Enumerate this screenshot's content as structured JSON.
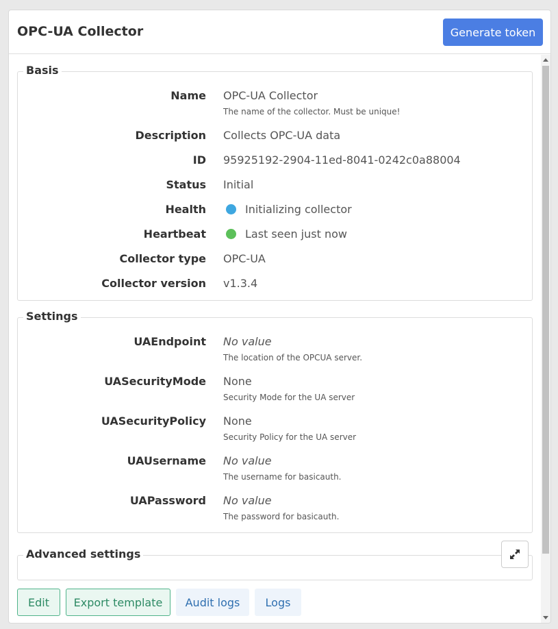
{
  "header": {
    "title": "OPC-UA Collector",
    "generate_token_label": "Generate token"
  },
  "basis": {
    "legend": "Basis",
    "name": {
      "label": "Name",
      "value": "OPC-UA Collector",
      "hint": "The name of the collector. Must be unique!"
    },
    "description": {
      "label": "Description",
      "value": "Collects OPC-UA data"
    },
    "id": {
      "label": "ID",
      "value": "95925192-2904-11ed-8041-0242c0a88004"
    },
    "status": {
      "label": "Status",
      "value": "Initial"
    },
    "health": {
      "label": "Health",
      "value": "Initializing collector",
      "color": "#3ea7e0"
    },
    "heartbeat": {
      "label": "Heartbeat",
      "value": "Last seen just now",
      "color": "#5cc05a"
    },
    "collector_type": {
      "label": "Collector type",
      "value": "OPC-UA"
    },
    "collector_version": {
      "label": "Collector version",
      "value": "v1.3.4"
    }
  },
  "settings": {
    "legend": "Settings",
    "ua_endpoint": {
      "label": "UAEndpoint",
      "value": "No value",
      "hint": "The location of the OPCUA server."
    },
    "ua_security_mode": {
      "label": "UASecurityMode",
      "value": "None",
      "hint": "Security Mode for the UA server"
    },
    "ua_security_policy": {
      "label": "UASecurityPolicy",
      "value": "None",
      "hint": "Security Policy for the UA server"
    },
    "ua_username": {
      "label": "UAUsername",
      "value": "No value",
      "hint": "The username for basicauth."
    },
    "ua_password": {
      "label": "UAPassword",
      "value": "No value",
      "hint": "The password for basicauth."
    }
  },
  "advanced": {
    "legend": "Advanced settings",
    "expand_icon": "expand-icon"
  },
  "actions": {
    "edit_label": "Edit",
    "export_template_label": "Export template",
    "audit_logs_label": "Audit logs",
    "logs_label": "Logs"
  },
  "colors": {
    "primary": "#4b7ee3",
    "success_outline": "#4fb38a",
    "info_light": "#eef4fb"
  }
}
